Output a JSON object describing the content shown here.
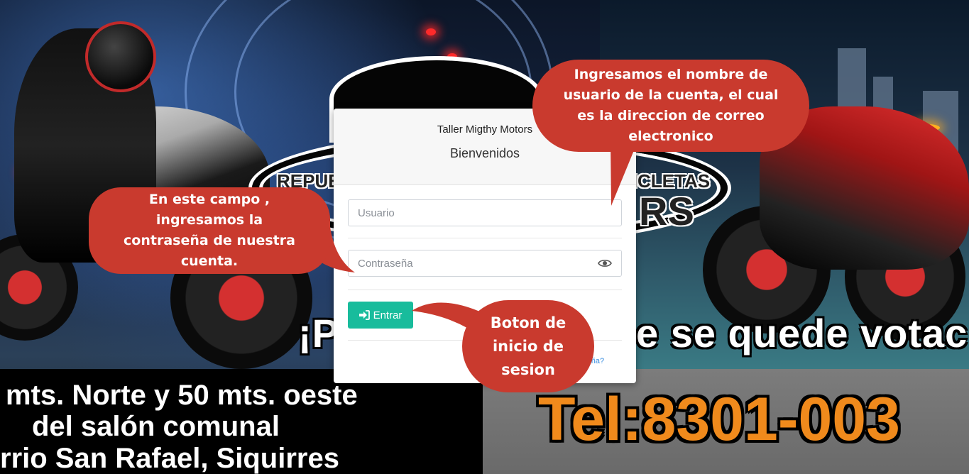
{
  "background": {
    "logo_left_word": "REPUE",
    "logo_right_word": "CICLETAS",
    "logo_brand_fragment": "RS",
    "slogan_left": "¡P",
    "slogan_right": "e se quede votac",
    "address_lines": [
      "mts. Norte y 50 mts. oeste",
      "del salón comunal",
      "rrio San Rafael, Siquirres"
    ],
    "phone": "Tel:8301-003"
  },
  "login": {
    "title": "Taller Migthy Motors",
    "subtitle": "Bienvenidos",
    "username_placeholder": "Usuario",
    "password_placeholder": "Contraseña",
    "enter_label": "Entrar",
    "forgot_label": "aseña?"
  },
  "callouts": {
    "username_note": "Ingresamos el nombre de usuario de la cuenta, el cual es la direccion de correo electronico",
    "password_note": "En este campo , ingresamos la contraseña de nuestra cuenta.",
    "button_note": "Boton de inicio de sesion"
  },
  "colors": {
    "callout": "#c93a2e",
    "button": "#18bc9c",
    "phone": "#f08a1c",
    "link": "#3b8ee0"
  },
  "icons": {
    "password_toggle": "eye-icon",
    "enter": "sign-in-icon"
  }
}
